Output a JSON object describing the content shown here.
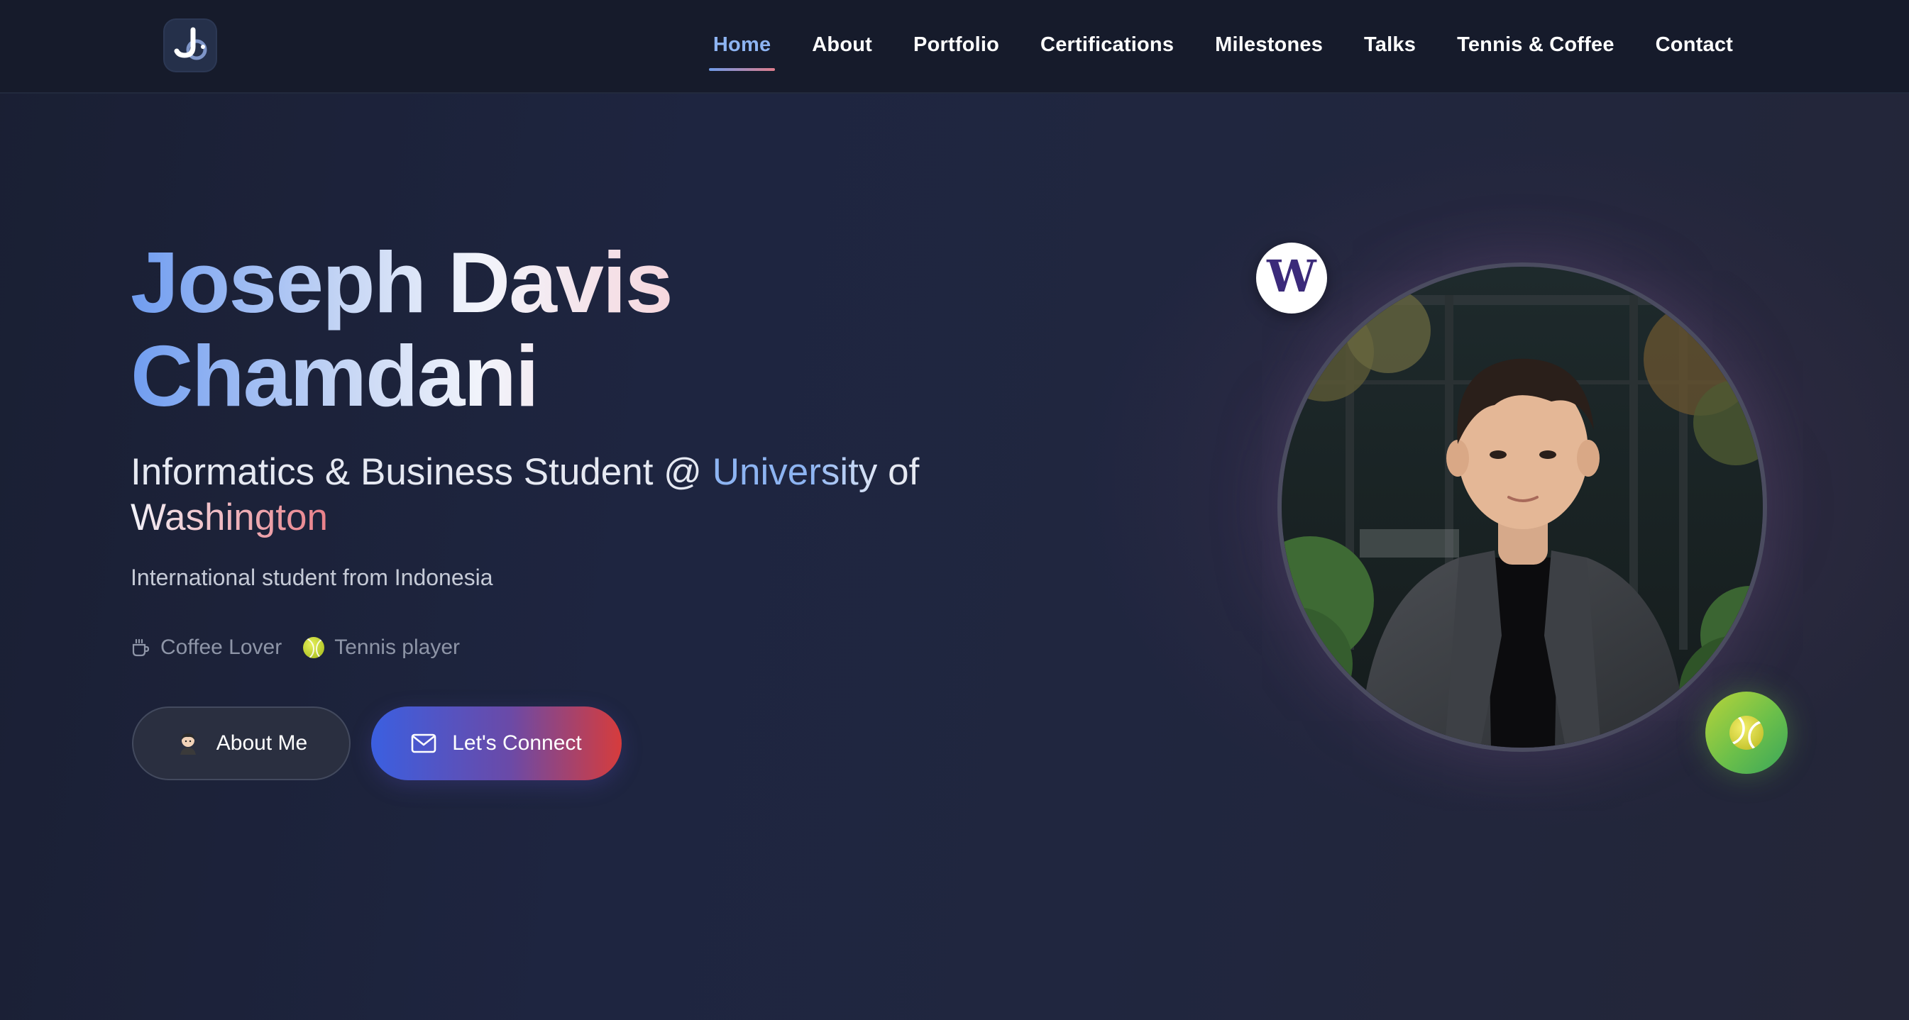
{
  "nav": {
    "logo_icon": "jc-monogram-icon",
    "links": [
      {
        "label": "Home",
        "active": true
      },
      {
        "label": "About",
        "active": false
      },
      {
        "label": "Portfolio",
        "active": false
      },
      {
        "label": "Certifications",
        "active": false
      },
      {
        "label": "Milestones",
        "active": false
      },
      {
        "label": "Talks",
        "active": false
      },
      {
        "label": "Tennis & Coffee",
        "active": false
      },
      {
        "label": "Contact",
        "active": false
      }
    ]
  },
  "hero": {
    "name_line1": "Joseph Davis",
    "name_line2": "Chamdani",
    "subtitle_part1": "Informatics & Business Student @ ",
    "subtitle_uni": "University",
    "subtitle_of": " of",
    "subtitle_wash": "Washington",
    "origin": "International student from Indonesia",
    "tags": [
      {
        "icon": "coffee-cup-icon",
        "label": "Coffee Lover"
      },
      {
        "icon": "tennis-ball-icon",
        "label": "Tennis player"
      }
    ],
    "buttons": {
      "about": {
        "label": "About Me",
        "icon": "avatar-icon"
      },
      "connect": {
        "label": "Let's Connect",
        "icon": "mail-icon"
      }
    }
  },
  "portrait": {
    "badge_letter": "W",
    "badge_icon": "uw-logo-icon",
    "tennis_icon": "tennis-ball-icon"
  },
  "colors": {
    "accent_blue": "#8db4f2",
    "accent_red": "#e07d8c",
    "button_gradient_start": "#3b5fe0",
    "button_gradient_end": "#d63c3c",
    "uw_purple": "#3b2a7a"
  }
}
